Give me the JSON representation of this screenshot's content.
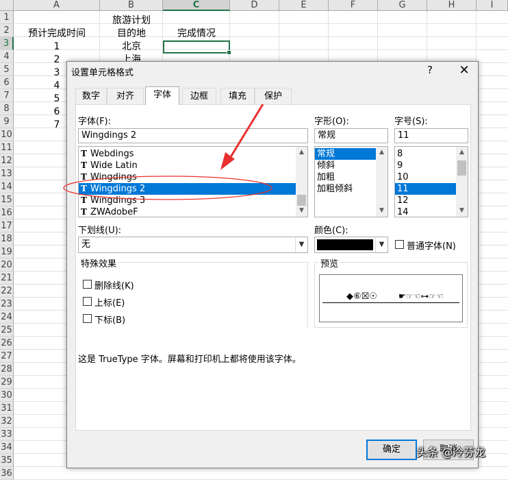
{
  "spreadsheet": {
    "columns": [
      "A",
      "B",
      "C",
      "D",
      "E",
      "F",
      "G",
      "H",
      "I"
    ],
    "selected_column": "C",
    "rows": [
      "1",
      "2",
      "3",
      "4",
      "5",
      "6",
      "7",
      "8",
      "9",
      "10",
      "11",
      "12",
      "13",
      "14",
      "15",
      "16",
      "17",
      "18",
      "19",
      "20",
      "21",
      "22",
      "23",
      "24",
      "25",
      "26",
      "27",
      "28",
      "29",
      "30",
      "31",
      "32",
      "33",
      "34",
      "35",
      "36"
    ],
    "selected_row": "3",
    "b1": "旅游计划",
    "header_a": "预计完成时间",
    "header_b": "目的地",
    "header_c": "完成情况",
    "a_values": [
      "1",
      "2",
      "3",
      "4",
      "5",
      "6",
      "7"
    ],
    "b_values": [
      "北京",
      "上海"
    ]
  },
  "dialog": {
    "title": "设置单元格格式",
    "help": "?",
    "close": "✕",
    "tabs": [
      "数字",
      "对齐",
      "字体",
      "边框",
      "填充",
      "保护"
    ],
    "active_tab": "字体",
    "font_label": "字体(F):",
    "font_value": "Wingdings 2",
    "font_list": [
      "Webdings",
      "Wide Latin",
      "Wingdings",
      "Wingdings 2",
      "Wingdings 3",
      "ZWAdobeF"
    ],
    "font_selected": "Wingdings 2",
    "style_label": "字形(O):",
    "style_value": "常规",
    "style_list": [
      "常规",
      "倾斜",
      "加粗",
      "加粗倾斜"
    ],
    "size_label": "字号(S):",
    "size_value": "11",
    "size_list": [
      "8",
      "9",
      "10",
      "11",
      "12",
      "14"
    ],
    "underline_label": "下划线(U):",
    "underline_value": "无",
    "color_label": "颜色(C):",
    "color_value": "#000000",
    "normal_font_label": "普通字体(N)",
    "effects_title": "特殊效果",
    "effects": [
      "删除线(K)",
      "上标(E)",
      "下标(B)"
    ],
    "preview_title": "预览",
    "preview_left": "◆⑥☒☉",
    "preview_right": "☛☞☜⊶☞☜",
    "description": "这是 TrueType 字体。屏幕和打印机上都将使用该字体。",
    "ok_label": "确定",
    "cancel_label": "取消"
  },
  "watermark": "头条 @冷芬龙",
  "colors": {
    "excel_green": "#217346",
    "selection_blue": "#0078d7",
    "annotation_red": "#e8312f"
  }
}
